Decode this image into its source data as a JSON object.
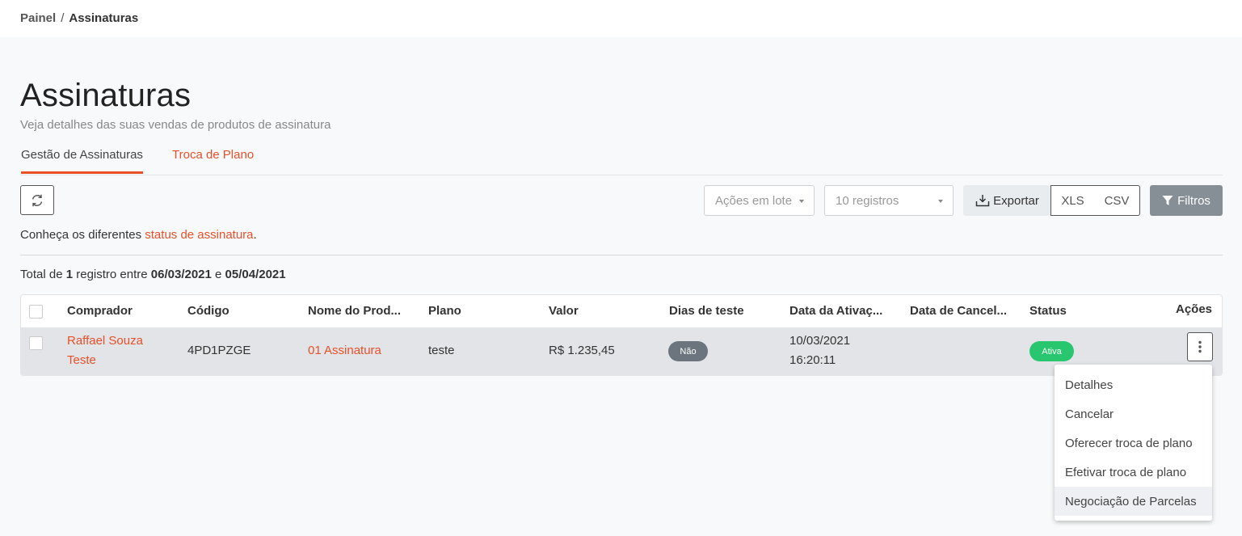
{
  "breadcrumb": {
    "root": "Painel",
    "separator": "/",
    "current": "Assinaturas"
  },
  "page": {
    "title": "Assinaturas",
    "subtitle": "Veja detalhes das suas vendas de produtos de assinatura"
  },
  "tabs": [
    {
      "label": "Gestão de Assinaturas",
      "active": true
    },
    {
      "label": "Troca de Plano",
      "active": false
    }
  ],
  "toolbar": {
    "refresh_icon": "refresh-icon",
    "bulk_actions": "Ações em lote",
    "page_size": "10 registros",
    "export_label": "Exportar",
    "xls_label": "XLS",
    "csv_label": "CSV",
    "filters_label": "Filtros"
  },
  "info": {
    "prefix": "Conheça os diferentes ",
    "link": "status de assinatura",
    "suffix": "."
  },
  "total": {
    "t1": "Total de ",
    "count": "1",
    "t2": " registro entre ",
    "date_start": "06/03/2021",
    "t3": " e ",
    "date_end": "05/04/2021"
  },
  "table": {
    "columns": [
      "Comprador",
      "Código",
      "Nome do Prod...",
      "Plano",
      "Valor",
      "Dias de teste",
      "Data da Ativaç...",
      "Data de Cancel...",
      "Status",
      "Ações"
    ],
    "rows": [
      {
        "buyer_line1": "Raffael Souza",
        "buyer_line2": "Teste",
        "code": "4PD1PZGE",
        "product": "01 Assinatura",
        "plan": "teste",
        "value": "R$ 1.235,45",
        "trial": "Não",
        "activation_date": "10/03/2021",
        "activation_time": "16:20:11",
        "cancel_date": "",
        "status": "Ativa"
      }
    ]
  },
  "actions_menu": {
    "items": [
      "Detalhes",
      "Cancelar",
      "Oferecer troca de plano",
      "Efetivar troca de plano",
      "Negociação de Parcelas"
    ],
    "hovered_index": 4
  },
  "colors": {
    "accent": "#e8502a",
    "status_active": "#28c76f",
    "badge_gray": "#6c757d",
    "filters_bg": "#868e96"
  }
}
